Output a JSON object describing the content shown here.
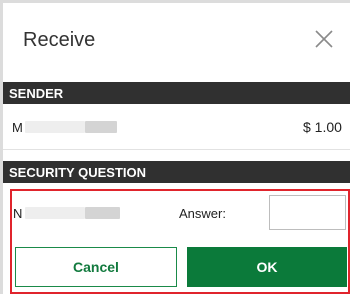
{
  "dialog": {
    "title": "Receive",
    "close_icon": "close-icon"
  },
  "sender": {
    "heading": "SENDER",
    "name_initial": "M",
    "amount": "$ 1.00"
  },
  "security": {
    "heading": "SECURITY QUESTION",
    "question_initial": "N",
    "answer_label": "Answer:",
    "answer_value": ""
  },
  "buttons": {
    "cancel_label": "Cancel",
    "ok_label": "OK"
  },
  "colors": {
    "section_bar": "#303030",
    "primary_green": "#0b7a3a",
    "highlight_red": "#e0242c"
  }
}
